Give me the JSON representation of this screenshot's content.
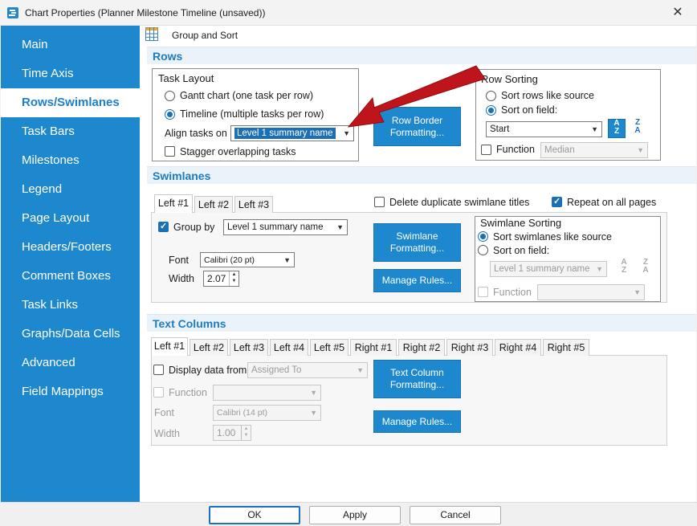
{
  "window": {
    "title": "Chart Properties (Planner Milestone Timeline (unsaved))",
    "close_glyph": "✕",
    "accent_color": "#1e88cf"
  },
  "sidebar": {
    "items": [
      {
        "label": "Main"
      },
      {
        "label": "Time Axis"
      },
      {
        "label": "Rows/Swimlanes",
        "active": true
      },
      {
        "label": "Task Bars"
      },
      {
        "label": "Milestones"
      },
      {
        "label": "Legend"
      },
      {
        "label": "Page Layout"
      },
      {
        "label": "Headers/Footers"
      },
      {
        "label": "Comment Boxes"
      },
      {
        "label": "Task Links"
      },
      {
        "label": "Graphs/Data Cells"
      },
      {
        "label": "Advanced"
      },
      {
        "label": "Field Mappings"
      }
    ]
  },
  "toolbar": {
    "grid_icon": "grid-icon",
    "group_sort_label": "Group and Sort"
  },
  "rows": {
    "section_title": "Rows",
    "task_layout": {
      "legend": "Task Layout",
      "gantt_label": "Gantt chart (one task per row)",
      "timeline_label": "Timeline (multiple tasks per row)",
      "align_label": "Align tasks on",
      "align_value": "Level 1 summary name",
      "stagger_label": "Stagger overlapping tasks"
    },
    "row_border_button": "Row Border Formatting...",
    "row_sorting": {
      "legend": "Row Sorting",
      "like_source_label": "Sort rows like source",
      "on_field_label": "Sort on field:",
      "field_value": "Start",
      "function_label": "Function",
      "function_value": "Median",
      "az_icon": "sort-ascending-icon",
      "za_icon": "sort-descending-icon"
    }
  },
  "swimlanes": {
    "section_title": "Swimlanes",
    "tabs": [
      "Left #1",
      "Left #2",
      "Left #3"
    ],
    "delete_dup_label": "Delete duplicate swimlane titles",
    "repeat_label": "Repeat on all pages",
    "group_by_label": "Group by",
    "group_by_value": "Level 1 summary name",
    "font_label": "Font",
    "font_value": "Calibri (20 pt)",
    "width_label": "Width",
    "width_value": "2.07",
    "formatting_button": "Swimlane Formatting...",
    "manage_rules_button": "Manage Rules...",
    "sorting": {
      "legend": "Swimlane Sorting",
      "like_source_label": "Sort swimlanes like source",
      "on_field_label": "Sort on field:",
      "field_value": "Level 1 summary name",
      "function_label": "Function",
      "function_value": ""
    }
  },
  "text_columns": {
    "section_title": "Text Columns",
    "tabs": [
      "Left #1",
      "Left #2",
      "Left #3",
      "Left #4",
      "Left #5",
      "Right #1",
      "Right #2",
      "Right #3",
      "Right #4",
      "Right #5"
    ],
    "display_label": "Display data from",
    "display_value": "Assigned To",
    "function_label": "Function",
    "function_value": "",
    "font_label": "Font",
    "font_value": "Calibri (14 pt)",
    "width_label": "Width",
    "width_value": "1.00",
    "formatting_button": "Text Column Formatting...",
    "manage_rules_button": "Manage Rules..."
  },
  "footer": {
    "ok": "OK",
    "apply": "Apply",
    "cancel": "Cancel"
  },
  "annotation": {
    "arrow_color": "#c0141c"
  }
}
